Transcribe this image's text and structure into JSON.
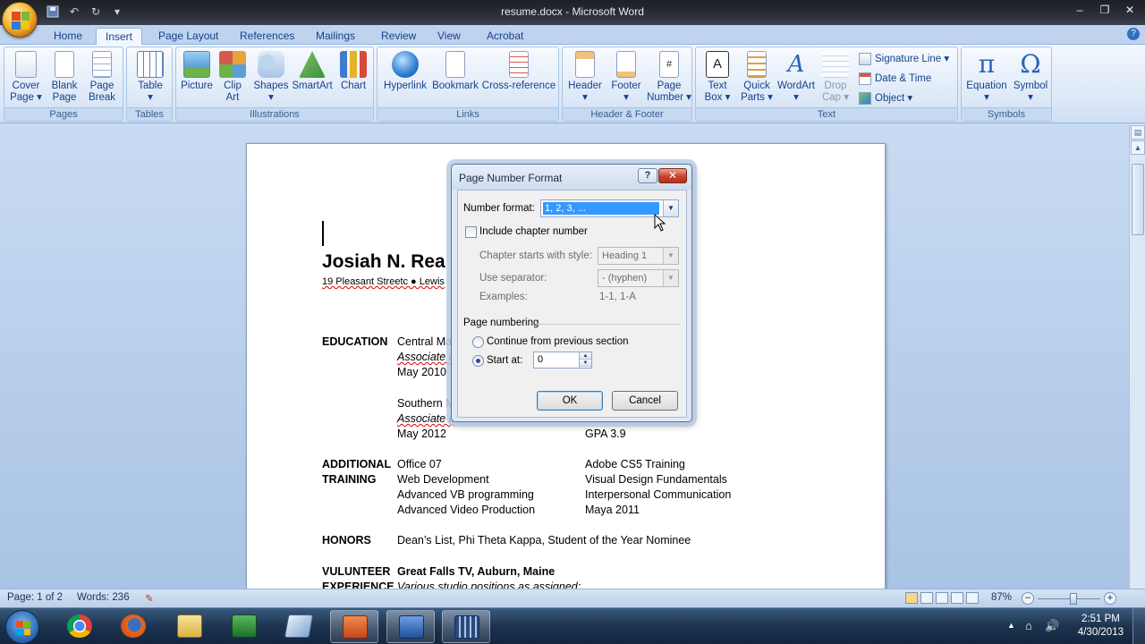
{
  "window": {
    "title": "resume.docx - Microsoft Word",
    "minimize": "–",
    "restore": "❐",
    "close": "✕"
  },
  "qat": {
    "save": "💾",
    "undo": "↶",
    "redo": "↻",
    "more": "▾"
  },
  "tabs": [
    "Home",
    "Insert",
    "Page Layout",
    "References",
    "Mailings",
    "Review",
    "View",
    "Acrobat"
  ],
  "active_tab": "Insert",
  "ribbon": {
    "groups": {
      "pages": "Pages",
      "tables": "Tables",
      "illustrations": "Illustrations",
      "links": "Links",
      "header_footer": "Header & Footer",
      "text": "Text",
      "symbols": "Symbols"
    },
    "buttons": {
      "cover_page": "Cover",
      "cover_page2": "Page ▾",
      "blank_page": "Blank",
      "blank_page2": "Page",
      "page_break": "Page",
      "page_break2": "Break",
      "table": "Table",
      "table2": "▾",
      "picture": "Picture",
      "clip_art": "Clip",
      "clip_art2": "Art",
      "shapes": "Shapes",
      "shapes2": "▾",
      "smartart": "SmartArt",
      "chart": "Chart",
      "hyperlink": "Hyperlink",
      "bookmark": "Bookmark",
      "cross_reference": "Cross-reference",
      "header": "Header",
      "header2": "▾",
      "footer": "Footer",
      "footer2": "▾",
      "page_number": "Page",
      "page_number2": "Number ▾",
      "text_box": "Text",
      "text_box2": "Box ▾",
      "quick_parts": "Quick",
      "quick_parts2": "Parts ▾",
      "wordart": "WordArt",
      "wordart2": "▾",
      "drop_cap": "Drop",
      "drop_cap2": "Cap ▾",
      "signature_line": "Signature Line ▾",
      "date_time": "Date & Time",
      "object": "Object ▾",
      "equation": "Equation",
      "equation2": "▾",
      "symbol": "Symbol",
      "symbol2": "▾"
    }
  },
  "document": {
    "name": "Josiah N. Rea",
    "address": "19 Pleasant Streetc ● Lewis",
    "education_label": "EDUCATION",
    "edu1_school": "Central Ma",
    "edu1_degree": "Associate d",
    "edu1_date": "May 2010",
    "edu2_school": "Southern M",
    "edu2_degree": "Associate d",
    "edu2_date": "May 2012",
    "edu2_gpa": "GPA 3.9",
    "training_label1": "ADDITIONAL",
    "training_label2": "TRAINING",
    "training_left": [
      "Office 07",
      "Web Development",
      "Advanced VB programming",
      "Advanced Video Production"
    ],
    "training_right": [
      "Adobe CS5 Training",
      "Visual Design Fundamentals",
      "Interpersonal Communication",
      "Maya 2011"
    ],
    "honors_label": "HONORS",
    "honors": "Dean’s List, Phi Theta Kappa, Student of the Year Nominee",
    "volunteer_label1": "VULUNTEER",
    "volunteer_label2": "EXPERIENCE",
    "volunteer_org": "Great Falls TV, Auburn, Maine",
    "volunteer_desc": "Various studio positions as assigned:"
  },
  "dialog": {
    "title": "Page Number Format",
    "help": "?",
    "close": "✕",
    "number_format_label": "Number format:",
    "number_format_value": "1, 2, 3, ...",
    "include_chapter_label": "Include chapter number",
    "chapter_style_label": "Chapter starts with style:",
    "chapter_style_value": "Heading 1",
    "separator_label": "Use separator:",
    "separator_value": "-   (hyphen)",
    "examples_label": "Examples:",
    "examples_value": "1-1, 1-A",
    "page_numbering_label": "Page numbering",
    "continue_label": "Continue from previous section",
    "start_at_label": "Start at:",
    "start_at_value": "0",
    "ok": "OK",
    "cancel": "Cancel"
  },
  "statusbar": {
    "page": "Page: 1 of 2",
    "words": "Words: 236",
    "zoom": "87%",
    "zoom_minus": "−",
    "zoom_plus": "+"
  },
  "taskbar": {
    "clock_time": "2:51 PM",
    "clock_date": "4/30/2013"
  }
}
